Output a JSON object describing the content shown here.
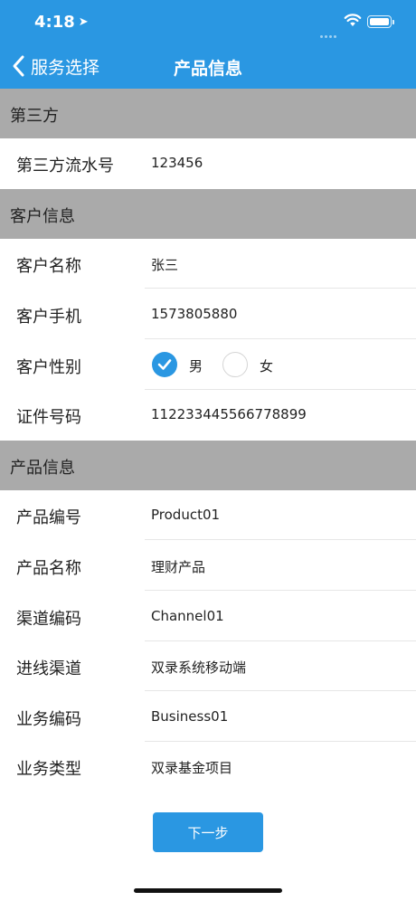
{
  "status_bar": {
    "time": "4:18",
    "location_icon": "location-arrow-icon",
    "wifi_icon": "wifi-icon",
    "battery_icon": "battery-icon"
  },
  "nav": {
    "back_label": "服务选择",
    "title": "产品信息",
    "color": "#2a97e2"
  },
  "sections": {
    "third_party": {
      "title": "第三方",
      "rows": [
        {
          "label": "第三方流水号",
          "value": "123456"
        }
      ]
    },
    "customer": {
      "title": "客户信息",
      "name": {
        "label": "客户名称",
        "value": "张三"
      },
      "phone": {
        "label": "客户手机",
        "value": "1573805880"
      },
      "gender": {
        "label": "客户性别",
        "options": [
          "男",
          "女"
        ],
        "selected": "男"
      },
      "id_number": {
        "label": "证件号码",
        "value": "112233445566778899"
      }
    },
    "product": {
      "title": "产品信息",
      "rows": [
        {
          "label": "产品编号",
          "value": "Product01"
        },
        {
          "label": "产品名称",
          "value": "理财产品"
        },
        {
          "label": "渠道编码",
          "value": "Channel01"
        },
        {
          "label": "进线渠道",
          "value": "双录系统移动端"
        },
        {
          "label": "业务编码",
          "value": "Business01"
        },
        {
          "label": "业务类型",
          "value": "双录基金项目"
        }
      ]
    }
  },
  "footer": {
    "next_label": "下一步"
  }
}
